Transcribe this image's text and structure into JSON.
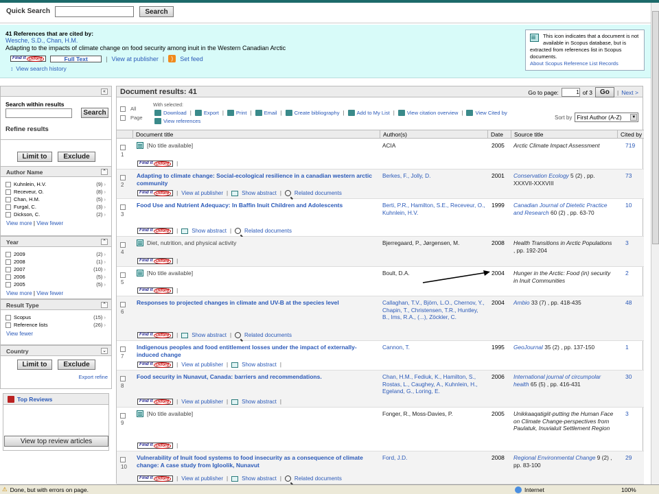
{
  "quick_search": {
    "label": "Quick Search",
    "button": "Search"
  },
  "refs": {
    "count_line": "41 References that are cited by:",
    "authors": "Wesche, S.D., Chan, H.M.",
    "title": "Adapting to the impacts of climate change on food security among inuit in the Western Canadian Arctic",
    "find_it": "Find it",
    "oxford": "Oxford",
    "full_text": "Full Text",
    "view_publisher": "View at publisher",
    "set_feed": "Set feed",
    "view_history": "View search history"
  },
  "infobox": {
    "text": "This icon indicates that a document is not available in Scopus database, but is extracted from references list in Scopus documents.",
    "link": "About Scopus Reference List Records"
  },
  "sidebar": {
    "search_within": "Search within results",
    "search_btn": "Search",
    "refine": "Refine results",
    "limit": "Limit to",
    "exclude": "Exclude",
    "author_name": "Author Name",
    "authors": [
      {
        "n": "Kuhnlein, H.V.",
        "c": "(9)"
      },
      {
        "n": "Receveur, O.",
        "c": "(8)"
      },
      {
        "n": "Chan, H.M.",
        "c": "(5)"
      },
      {
        "n": "Furgal, C.",
        "c": "(3)"
      },
      {
        "n": "Dickson, C.",
        "c": "(2)"
      }
    ],
    "view_more": "View more",
    "view_fewer": "View fewer",
    "year": "Year",
    "years": [
      {
        "n": "2009",
        "c": "(2)"
      },
      {
        "n": "2008",
        "c": "(1)"
      },
      {
        "n": "2007",
        "c": "(10)"
      },
      {
        "n": "2006",
        "c": "(5)"
      },
      {
        "n": "2005",
        "c": "(5)"
      }
    ],
    "result_type": "Result Type",
    "types": [
      {
        "n": "Scopus",
        "c": "(15)"
      },
      {
        "n": "Reference lists",
        "c": "(26)"
      }
    ],
    "country": "Country",
    "export_refine": "Export refine",
    "top_reviews": "Top Reviews",
    "view_top": "View top review articles"
  },
  "results": {
    "title": "Document results: 41",
    "goto": "Go to page:",
    "page": "1",
    "of": "of 3",
    "go": "Go",
    "next": "Next >",
    "all": "All",
    "page_lbl": "Page",
    "with_selected": "With selected:",
    "tools": [
      "Download",
      "Export",
      "Print",
      "Email",
      "Create bibliography",
      "Add to My List",
      "View citation overview",
      "View Cited by",
      "View references"
    ],
    "sort_by": "Sort by",
    "sort_value": "First Author (A-Z)",
    "cols": [
      "Document title",
      "Author(s)",
      "Date",
      "Source title",
      "Cited by"
    ],
    "show_abstract": "Show abstract",
    "related": "Related documents",
    "rows": [
      {
        "num": "1",
        "title": "[No title available]",
        "authors": "ACIA",
        "date": "2005",
        "source": "Arctic Climate Impact Assessment",
        "src_pl": "",
        "cited": "719"
      },
      {
        "num": "2",
        "title": "Adapting to climate change: Social-ecological resilience in a canadian western arctic community",
        "authors": "Berkes, F., Jolly, D.",
        "date": "2001",
        "source": "Conservation Ecology",
        "src_pl": " 5 (2) , pp. XXXVII-XXXVIII",
        "cited": "73"
      },
      {
        "num": "3",
        "title": "Food Use and Nutrient Adequacy: In Baffin Inuit Children and Adolescents",
        "authors": "Berti, P.R., Hamilton, S.E., Receveur, O., Kuhnlein, H.V.",
        "date": "1999",
        "source": "Canadian Journal of Dietetic Practice and Research",
        "src_pl": " 60 (2) , pp. 63-70",
        "cited": "10"
      },
      {
        "num": "4",
        "title": "Diet, nutrition, and physical activity",
        "authors": "Bjerregaard, P., Jørgensen, M.",
        "date": "2008",
        "source": "Health Transitions in Arctic Populations",
        "src_pl": " , pp. 192-204",
        "cited": "3"
      },
      {
        "num": "5",
        "title": "[No title available]",
        "authors": "Boult, D.A.",
        "date": "2004",
        "source": "Hunger in the Arctic: Food (in) security in Inuit Communities",
        "src_pl": "",
        "cited": "2"
      },
      {
        "num": "6",
        "title": "Responses to projected changes in climate and UV-B at the species level",
        "authors": "Callaghan, T.V., Björn, L.O., Chernov, Y., Chapin, T., Christensen, T.R., Huntley, B., Ims, R.A., (...), Zöckler, C.",
        "date": "2004",
        "source": "Ambio",
        "src_pl": " 33 (7) , pp. 418-435",
        "cited": "48"
      },
      {
        "num": "7",
        "title": "Indigenous peoples and food entitlement losses under the impact of externally-induced change",
        "authors": "Cannon, T.",
        "date": "1995",
        "source": "GeoJournal",
        "src_pl": " 35 (2) , pp. 137-150",
        "cited": "1"
      },
      {
        "num": "8",
        "title": "Food security in Nunavut, Canada: barriers and recommendations.",
        "authors": "Chan, H.M., Fediuk, K., Hamilton, S., Rostas, L., Caughey, A., Kuhnlein, H., Egeland, G., Loring, E.",
        "date": "2006",
        "source": "International journal of circumpolar health",
        "src_pl": " 65 (5) , pp. 416-431",
        "cited": "30"
      },
      {
        "num": "9",
        "title": "[No title available]",
        "authors": "Fonger, R., Moss-Davies, P.",
        "date": "2005",
        "source": "Unikkaaqatigiit-putting the Human Face on Climate Change-perspectives from Paulatuk, Inuvialuit Settlement Region",
        "src_pl": "",
        "cited": "3"
      },
      {
        "num": "10",
        "title": "Vulnerability of Inuit food systems to food insecurity as a consequence of climate change: A case study from Igloolik, Nunavut",
        "authors": "Ford, J.D.",
        "date": "2008",
        "source": "Regional Environmental Change",
        "src_pl": " 9 (2) , pp. 83-100",
        "cited": "29"
      }
    ]
  },
  "status": {
    "text": "Done, but with errors on page.",
    "zone": "Internet",
    "zoom": "100%"
  }
}
